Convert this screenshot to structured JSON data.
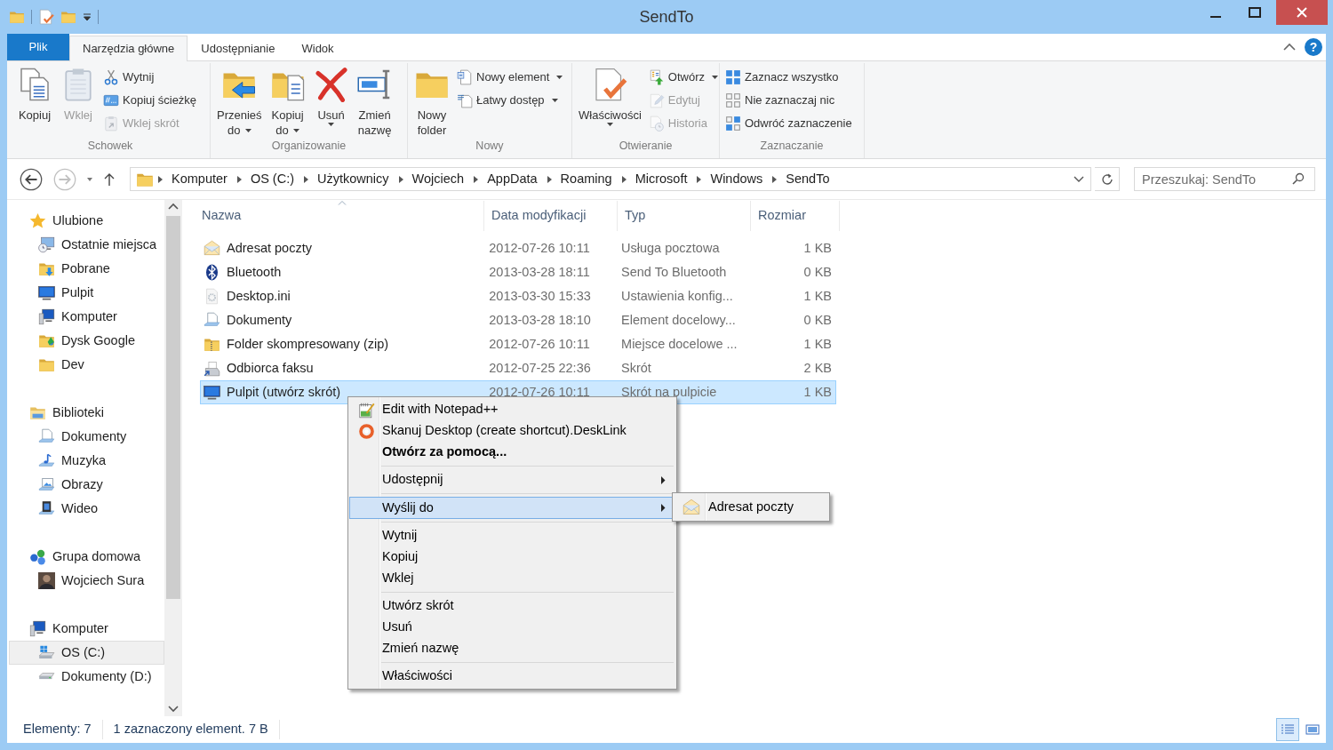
{
  "window": {
    "title": "SendTo"
  },
  "ribbon": {
    "tabs": [
      {
        "label": "Plik",
        "kind": "file",
        "selected": false
      },
      {
        "label": "Narzędzia główne",
        "kind": "tab",
        "selected": true
      },
      {
        "label": "Udostępnianie",
        "kind": "tab",
        "selected": false
      },
      {
        "label": "Widok",
        "kind": "tab",
        "selected": false
      }
    ],
    "help": "?",
    "groups": [
      {
        "label": "Schowek",
        "items": [
          {
            "kind": "large",
            "lines": [
              "Kopiuj"
            ],
            "disabled": false
          },
          {
            "kind": "large",
            "lines": [
              "Wklej"
            ],
            "disabled": true
          },
          {
            "kind": "stack",
            "items": [
              {
                "label": "Wytnij",
                "disabled": false,
                "dropdown": false
              },
              {
                "label": "Kopiuj ścieżkę",
                "disabled": false,
                "dropdown": false
              },
              {
                "label": "Wklej skrót",
                "disabled": true,
                "dropdown": false
              }
            ]
          }
        ]
      },
      {
        "label": "Organizowanie",
        "items": [
          {
            "kind": "large",
            "lines": [
              "Przenieś",
              "do"
            ],
            "dropdown": true,
            "disabled": false
          },
          {
            "kind": "large",
            "lines": [
              "Kopiuj",
              "do"
            ],
            "dropdown": true,
            "disabled": false
          },
          {
            "kind": "large",
            "lines": [
              "Usuń"
            ],
            "dropdown": true,
            "disabled": false
          },
          {
            "kind": "large",
            "lines": [
              "Zmień",
              "nazwę"
            ],
            "dropdown": false,
            "disabled": false
          }
        ]
      },
      {
        "label": "Nowy",
        "items": [
          {
            "kind": "large",
            "lines": [
              "Nowy",
              "folder"
            ],
            "disabled": false
          },
          {
            "kind": "stack",
            "items": [
              {
                "label": "Nowy element",
                "disabled": false,
                "dropdown": true
              },
              {
                "label": "Łatwy dostęp",
                "disabled": false,
                "dropdown": true
              }
            ]
          }
        ]
      },
      {
        "label": "Otwieranie",
        "items": [
          {
            "kind": "large",
            "lines": [
              "Właściwości"
            ],
            "dropdown": true,
            "disabled": false
          },
          {
            "kind": "stack",
            "items": [
              {
                "label": "Otwórz",
                "disabled": false,
                "dropdown": true
              },
              {
                "label": "Edytuj",
                "disabled": true,
                "dropdown": false
              },
              {
                "label": "Historia",
                "disabled": true,
                "dropdown": false
              }
            ]
          }
        ]
      },
      {
        "label": "Zaznaczanie",
        "items": [
          {
            "kind": "stack",
            "items": [
              {
                "label": "Zaznacz wszystko",
                "disabled": false,
                "dropdown": false
              },
              {
                "label": "Nie zaznaczaj nic",
                "disabled": false,
                "dropdown": false
              },
              {
                "label": "Odwróć zaznaczenie",
                "disabled": false,
                "dropdown": false
              }
            ]
          }
        ]
      }
    ]
  },
  "address": {
    "path": [
      "Komputer",
      "OS (C:)",
      "Użytkownicy",
      "Wojciech",
      "AppData",
      "Roaming",
      "Microsoft",
      "Windows",
      "SendTo"
    ],
    "search": {
      "placeholder": "Przeszukaj: SendTo"
    }
  },
  "navigation": [
    {
      "label": "Ulubione",
      "selected": false,
      "children": [
        {
          "label": "Ostatnie miejsca",
          "selected": false
        },
        {
          "label": "Pobrane",
          "selected": false
        },
        {
          "label": "Pulpit",
          "selected": false
        },
        {
          "label": "Komputer",
          "selected": false
        },
        {
          "label": "Dysk Google",
          "selected": false
        },
        {
          "label": "Dev",
          "selected": false
        }
      ]
    },
    {
      "label": "Biblioteki",
      "selected": false,
      "children": [
        {
          "label": "Dokumenty",
          "selected": false
        },
        {
          "label": "Muzyka",
          "selected": false
        },
        {
          "label": "Obrazy",
          "selected": false
        },
        {
          "label": "Wideo",
          "selected": false
        }
      ]
    },
    {
      "label": "Grupa domowa",
      "selected": false,
      "children": [
        {
          "label": "Wojciech Sura",
          "selected": false
        }
      ]
    },
    {
      "label": "Komputer",
      "selected": false,
      "children": [
        {
          "label": "OS (C:)",
          "selected": true
        },
        {
          "label": "Dokumenty (D:)",
          "selected": false
        }
      ]
    }
  ],
  "file_list": {
    "columns": [
      {
        "label": "Nazwa",
        "sorted": true
      },
      {
        "label": "Data modyfikacji",
        "sorted": false
      },
      {
        "label": "Typ",
        "sorted": false
      },
      {
        "label": "Rozmiar",
        "sorted": false
      }
    ],
    "rows": [
      {
        "name": "Adresat poczty",
        "date": "2012-07-26 10:11",
        "type": "Usługa pocztowa",
        "size": "1 KB",
        "selected": false
      },
      {
        "name": "Bluetooth",
        "date": "2013-03-28 18:11",
        "type": "Send To Bluetooth",
        "size": "0 KB",
        "selected": false
      },
      {
        "name": "Desktop.ini",
        "date": "2013-03-30 15:33",
        "type": "Ustawienia konfig...",
        "size": "1 KB",
        "selected": false
      },
      {
        "name": "Dokumenty",
        "date": "2013-03-28 18:10",
        "type": "Element docelowy...",
        "size": "0 KB",
        "selected": false
      },
      {
        "name": "Folder skompresowany (zip)",
        "date": "2012-07-26 10:11",
        "type": "Miejsce docelowe ...",
        "size": "1 KB",
        "selected": false
      },
      {
        "name": "Odbiorca faksu",
        "date": "2012-07-25 22:36",
        "type": "Skrót",
        "size": "2 KB",
        "selected": false
      },
      {
        "name": "Pulpit (utwórz skrót)",
        "date": "2012-07-26 10:11",
        "type": "Skrót na pulpicie",
        "size": "1 KB",
        "selected": true
      }
    ]
  },
  "context_menu": {
    "groups": [
      [
        {
          "label": "Edit with Notepad++",
          "default": false,
          "submenu": false,
          "selected": false
        },
        {
          "label": "Skanuj Desktop (create shortcut).DeskLink",
          "default": false,
          "submenu": false,
          "selected": false
        },
        {
          "label": "Otwórz za pomocą...",
          "default": true,
          "submenu": false,
          "selected": false
        }
      ],
      [
        {
          "label": "Udostępnij",
          "default": false,
          "submenu": true,
          "selected": false
        }
      ],
      [
        {
          "label": "Wyślij do",
          "default": false,
          "submenu": true,
          "selected": true
        }
      ],
      [
        {
          "label": "Wytnij",
          "default": false,
          "submenu": false,
          "selected": false
        },
        {
          "label": "Kopiuj",
          "default": false,
          "submenu": false,
          "selected": false
        },
        {
          "label": "Wklej",
          "default": false,
          "submenu": false,
          "selected": false
        }
      ],
      [
        {
          "label": "Utwórz skrót",
          "default": false,
          "submenu": false,
          "selected": false
        },
        {
          "label": "Usuń",
          "default": false,
          "submenu": false,
          "selected": false
        },
        {
          "label": "Zmień nazwę",
          "default": false,
          "submenu": false,
          "selected": false
        }
      ],
      [
        {
          "label": "Właściwości",
          "default": false,
          "submenu": false,
          "selected": false
        }
      ]
    ],
    "submenu": [
      {
        "label": "Adresat poczty",
        "selected": false
      }
    ]
  },
  "status_bar": {
    "items": "Elementy: 7",
    "selection": "1 zaznaczony element. 7 B",
    "views": [
      {
        "kind": "details",
        "selected": true
      },
      {
        "kind": "large-icons",
        "selected": false
      }
    ]
  }
}
